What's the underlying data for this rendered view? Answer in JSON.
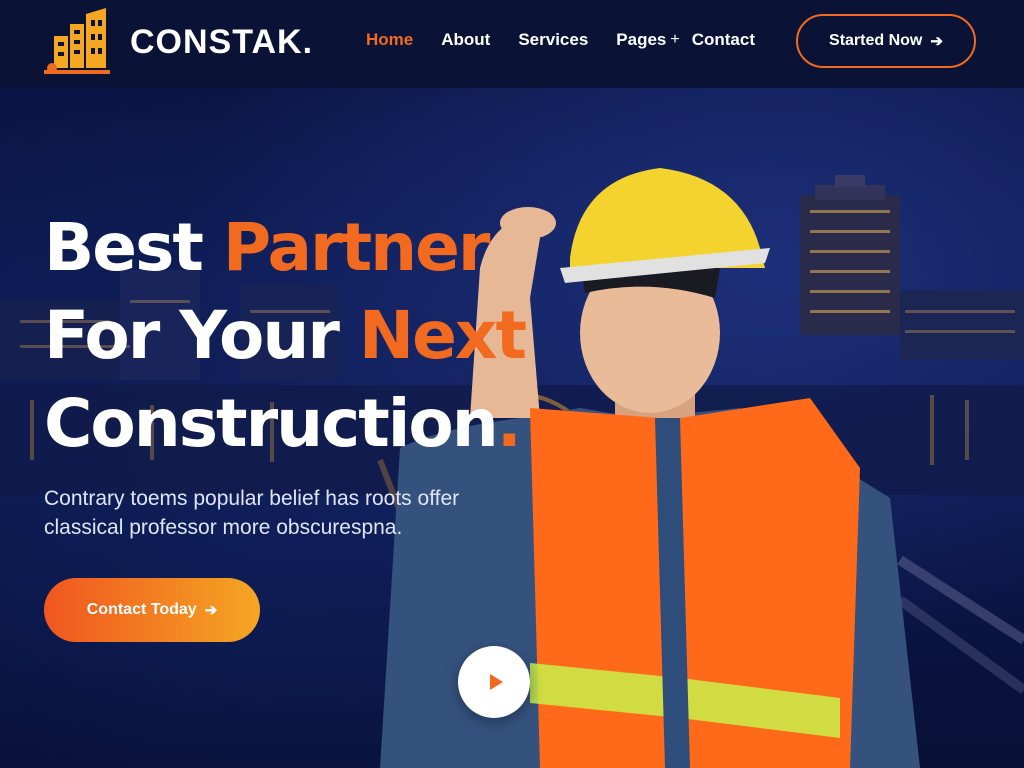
{
  "brand": {
    "name": "CONSTAK.",
    "accent": "#f26a1f"
  },
  "nav": {
    "items": [
      {
        "label": "Home",
        "active": true
      },
      {
        "label": "About",
        "active": false
      },
      {
        "label": "Services",
        "active": false
      },
      {
        "label": "Pages",
        "active": false,
        "expand": "+"
      },
      {
        "label": "Contact",
        "active": false
      }
    ],
    "cta_label": "Started Now",
    "cta_icon": "arrow-right-icon"
  },
  "hero": {
    "headline": {
      "line1_a": "Best ",
      "line1_b": "Partner",
      "line2_a": "For Your ",
      "line2_b": "Next",
      "line3_a": "Construction",
      "line3_b": "."
    },
    "subtext": "Contrary toems popular belief has roots offer classical professor more obscurespna.",
    "cta_label": "Contact Today",
    "cta_icon": "arrow-right-icon",
    "play_icon": "play-icon"
  },
  "colors": {
    "background": "#0b1540",
    "accent": "#f26a1f",
    "gradient_end": "#f5a623"
  }
}
